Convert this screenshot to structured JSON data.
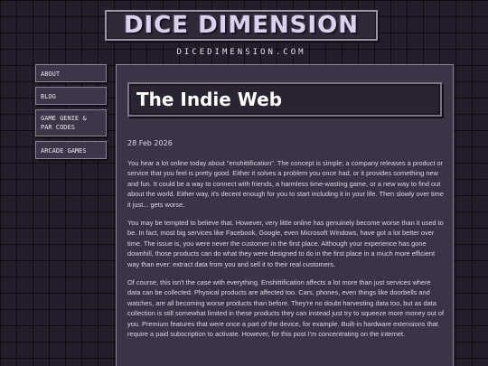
{
  "header": {
    "logo_text": "DICE DIMENSION",
    "site_url": "DICEDIMENSION.COM"
  },
  "nav": {
    "items": [
      {
        "label": "About"
      },
      {
        "label": "Blog"
      },
      {
        "label": "Game Genie & Par Codes"
      },
      {
        "label": "Arcade Games"
      }
    ]
  },
  "post": {
    "title": "The Indie Web",
    "date": "28 Feb 2026",
    "paragraphs": [
      "You hear a lot online today about \"enshittification\". The concept is simple; a company releases a product or service that you feel is pretty good. Either it solves a problem you once had, or it provides something new and fun. It could be a way to connect with friends, a harmless time-wasting game, or a new way to find out about the world. Either way, it's decent enough for you to start including it in your life. Then slowly over time it just... gets worse.",
      "You may be tempted to believe that. However, very little online has genuinely become worse than it used to be. In fact, most big services like Facebook, Google, even Microsoft Windows, have got a lot better over time. The issue is, you were never the customer in the first place. Although your experience has gone downhill, those products can do what they were designed to do in the first place in a much more efficient way than ever: extract data from you and sell it to their real customers.",
      "Of course, this isn't the case with everything. Enshittification affects a lot more than just services where data can be collected. Physical products are affected too. Cars, phones, even things like doorbells and watches, are all becoming worse products than before. They're no doubt harvesting data too, but as data collection is still somewhat limited in these products they can instead just try to squeeze more money out of you. Premium features that were once a part of the device, for example. Built-in hardware extensions that require a paid subscription to activate. However, for this post I'm concentrating on the internet."
    ]
  },
  "colors": {
    "background": "#241d2b",
    "panel": "#3b3446",
    "title_box": "#2a2332",
    "border": "#8a8396",
    "text": "#dcd7e5"
  }
}
